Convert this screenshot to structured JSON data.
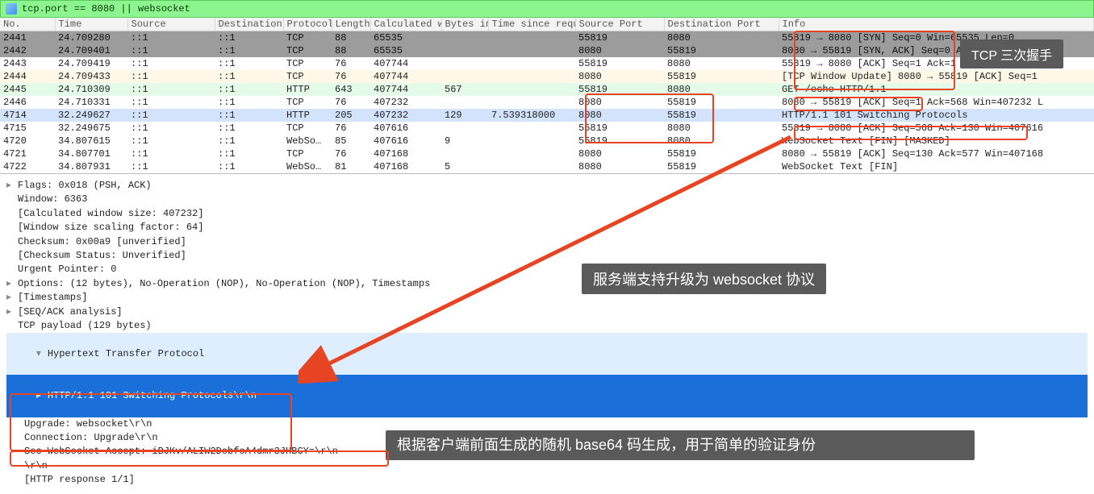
{
  "filter": {
    "value": "tcp.port == 8080 || websocket"
  },
  "columns": [
    "No.",
    "Time",
    "Source",
    "Destination",
    "Protocol",
    "Length",
    "Calculated w",
    "Bytes in f",
    "Time since requ",
    "Source Port",
    "Destination Port",
    "Info"
  ],
  "rows": [
    {
      "style": "row-gray",
      "no": "2441",
      "time": "24.709280",
      "src": "::1",
      "dst": "::1",
      "proto": "TCP",
      "len": "88",
      "calc": "65535",
      "bytes": "",
      "tsreq": "",
      "sport": "55819",
      "dport": "8080",
      "info": "55819 → 8080 [SYN] Seq=0 Win=65535 Len=0"
    },
    {
      "style": "row-gray",
      "no": "2442",
      "time": "24.709401",
      "src": "::1",
      "dst": "::1",
      "proto": "TCP",
      "len": "88",
      "calc": "65535",
      "bytes": "",
      "tsreq": "",
      "sport": "8080",
      "dport": "55819",
      "info": "8080 → 55819 [SYN, ACK] Seq=0 Ack=1 Win=65535"
    },
    {
      "style": "row-white",
      "no": "2443",
      "time": "24.709419",
      "src": "::1",
      "dst": "::1",
      "proto": "TCP",
      "len": "76",
      "calc": "407744",
      "bytes": "",
      "tsreq": "",
      "sport": "55819",
      "dport": "8080",
      "info": "55819 → 8080 [ACK] Seq=1 Ack=1 Win=407744 Len"
    },
    {
      "style": "row-cream",
      "no": "2444",
      "time": "24.709433",
      "src": "::1",
      "dst": "::1",
      "proto": "TCP",
      "len": "76",
      "calc": "407744",
      "bytes": "",
      "tsreq": "",
      "sport": "8080",
      "dport": "55819",
      "info": "[TCP Window Update] 8080 → 55819 [ACK] Seq=1"
    },
    {
      "style": "row-green",
      "no": "2445",
      "time": "24.710309",
      "src": "::1",
      "dst": "::1",
      "proto": "HTTP",
      "len": "643",
      "calc": "407744",
      "bytes": "567",
      "tsreq": "",
      "sport": "55819",
      "dport": "8080",
      "info": "GET /echo HTTP/1.1"
    },
    {
      "style": "row-white",
      "no": "2446",
      "time": "24.710331",
      "src": "::1",
      "dst": "::1",
      "proto": "TCP",
      "len": "76",
      "calc": "407232",
      "bytes": "",
      "tsreq": "",
      "sport": "8080",
      "dport": "55819",
      "info": "8080 → 55819 [ACK] Seq=1 Ack=568 Win=407232 L"
    },
    {
      "style": "row-blue",
      "no": "4714",
      "time": "32.249627",
      "src": "::1",
      "dst": "::1",
      "proto": "HTTP",
      "len": "205",
      "calc": "407232",
      "bytes": "129",
      "tsreq": "7.539318000",
      "sport": "8080",
      "dport": "55819",
      "info": "HTTP/1.1 101 Switching Protocols"
    },
    {
      "style": "row-white",
      "no": "4715",
      "time": "32.249675",
      "src": "::1",
      "dst": "::1",
      "proto": "TCP",
      "len": "76",
      "calc": "407616",
      "bytes": "",
      "tsreq": "",
      "sport": "55819",
      "dport": "8080",
      "info": "55819 → 8080 [ACK] Seq=568 Ack=130 Win=407616"
    },
    {
      "style": "row-white",
      "no": "4720",
      "time": "34.807615",
      "src": "::1",
      "dst": "::1",
      "proto": "WebSo…",
      "len": "85",
      "calc": "407616",
      "bytes": "9",
      "tsreq": "",
      "sport": "55819",
      "dport": "8080",
      "info": "WebSocket Text [FIN] [MASKED]"
    },
    {
      "style": "row-white",
      "no": "4721",
      "time": "34.807701",
      "src": "::1",
      "dst": "::1",
      "proto": "TCP",
      "len": "76",
      "calc": "407168",
      "bytes": "",
      "tsreq": "",
      "sport": "8080",
      "dport": "55819",
      "info": "8080 → 55819 [ACK] Seq=130 Ack=577 Win=407168"
    },
    {
      "style": "row-white",
      "no": "4722",
      "time": "34.807931",
      "src": "::1",
      "dst": "::1",
      "proto": "WebSo…",
      "len": "81",
      "calc": "407168",
      "bytes": "5",
      "tsreq": "",
      "sport": "8080",
      "dport": "55819",
      "info": "WebSocket Text [FIN]"
    }
  ],
  "details": {
    "lines": [
      {
        "caret": ">",
        "text": "Flags: 0x018 (PSH, ACK)"
      },
      {
        "caret": " ",
        "text": "Window: 6363"
      },
      {
        "caret": " ",
        "text": "[Calculated window size: 407232]"
      },
      {
        "caret": " ",
        "text": "[Window size scaling factor: 64]"
      },
      {
        "caret": " ",
        "text": "Checksum: 0x00a9 [unverified]"
      },
      {
        "caret": " ",
        "text": "[Checksum Status: Unverified]"
      },
      {
        "caret": " ",
        "text": "Urgent Pointer: 0"
      },
      {
        "caret": ">",
        "text": "Options: (12 bytes), No-Operation (NOP), No-Operation (NOP), Timestamps"
      },
      {
        "caret": ">",
        "text": "[Timestamps]"
      },
      {
        "caret": ">",
        "text": "[SEQ/ACK analysis]"
      },
      {
        "caret": " ",
        "text": "TCP payload (129 bytes)"
      }
    ],
    "htp_header": "Hypertext Transfer Protocol",
    "htp_blue": "HTTP/1.1 101 Switching Protocols\\r\\n",
    "htp_after": [
      "Upgrade: websocket\\r\\n",
      "Connection: Upgrade\\r\\n",
      "Sec-WebSocket-Accept: iBJKv/ALIW2DobfoA4dmr3JHBCY=\\r\\n",
      "\\r\\n",
      "[HTTP response 1/1]"
    ]
  },
  "annotations": {
    "tcp_handshake": "TCP 三次握手",
    "server_upgrade": "服务端支持升级为 websocket 协议",
    "base64_note": "根据客户端前面生成的随机 base64 码生成，用于简单的验证身份"
  }
}
